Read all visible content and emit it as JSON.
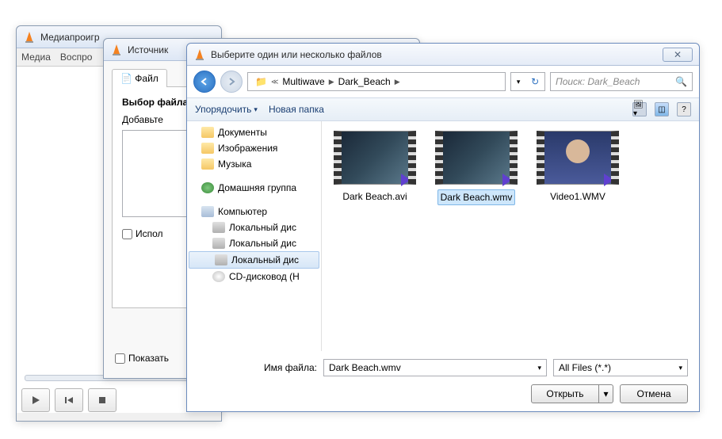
{
  "main_window": {
    "title": "Медиапроигр",
    "menu": {
      "media": "Медиа",
      "playback": "Воспро"
    }
  },
  "source_dialog": {
    "title": "Источник",
    "tab_file": "Файл",
    "file_selection": "Выбор файла",
    "add_label": "Добавьте",
    "use_checkbox": "Испол",
    "show_more": "Показать"
  },
  "file_dialog": {
    "title": "Выберите один или несколько файлов",
    "breadcrumb": {
      "seg1": "Multiwave",
      "seg2": "Dark_Beach"
    },
    "search_placeholder": "Поиск: Dark_Beach",
    "toolbar": {
      "organize": "Упорядочить",
      "new_folder": "Новая папка"
    },
    "tree": {
      "documents": "Документы",
      "images": "Изображения",
      "music": "Музыка",
      "homegroup": "Домашняя группа",
      "computer": "Компьютер",
      "local_disk": "Локальный дис",
      "cd_drive": "CD-дисковод (H"
    },
    "files": [
      {
        "name": "Dark Beach.avi"
      },
      {
        "name": "Dark Beach.wmv"
      },
      {
        "name": "Video1.WMV"
      }
    ],
    "filename_label": "Имя файла:",
    "filename_value": "Dark Beach.wmv",
    "filter": "All Files (*.*)",
    "open_btn": "Открыть",
    "cancel_btn": "Отмена"
  }
}
